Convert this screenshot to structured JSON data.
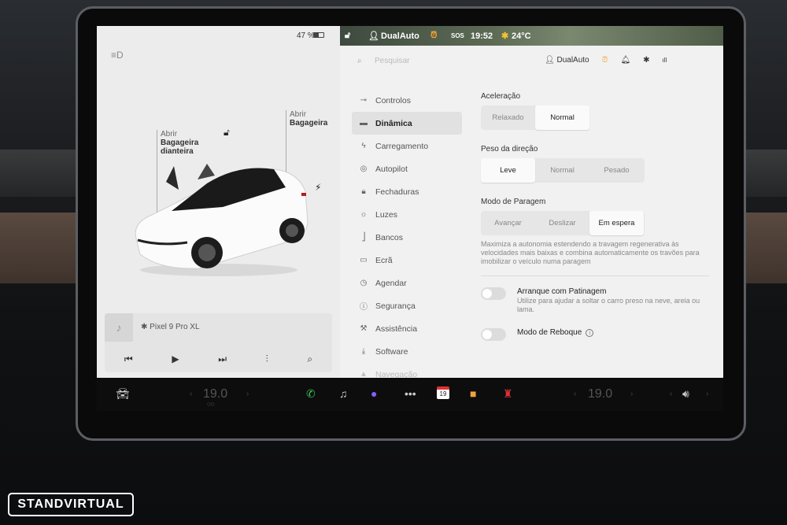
{
  "status": {
    "battery": "47 %",
    "profile": "DualAuto",
    "sos": "SOS",
    "time": "19:52",
    "temperature": "24°C"
  },
  "left_panel": {
    "trunk_front": {
      "line1": "Abrir",
      "line2": "Bagageira",
      "line3": "dianteira"
    },
    "trunk_rear": {
      "line1": "Abrir",
      "line2": "Bagageira"
    },
    "media": {
      "source": "Pixel 9 Pro XL"
    }
  },
  "search": {
    "placeholder": "Pesquisar"
  },
  "profile_name": "DualAuto",
  "menu": [
    {
      "label": "Controlos",
      "icon": "toggle-icon"
    },
    {
      "label": "Dinâmica",
      "icon": "car-icon"
    },
    {
      "label": "Carregamento",
      "icon": "bolt-icon"
    },
    {
      "label": "Autopilot",
      "icon": "steering-icon"
    },
    {
      "label": "Fechaduras",
      "icon": "lock-icon"
    },
    {
      "label": "Luzes",
      "icon": "sun-icon"
    },
    {
      "label": "Bancos",
      "icon": "seat-icon"
    },
    {
      "label": "Ecrã",
      "icon": "screen-icon"
    },
    {
      "label": "Agendar",
      "icon": "clock-icon"
    },
    {
      "label": "Segurança",
      "icon": "shield-icon"
    },
    {
      "label": "Assistência",
      "icon": "wrench-icon"
    },
    {
      "label": "Software",
      "icon": "download-icon"
    },
    {
      "label": "Navegação",
      "icon": "navigation-icon"
    }
  ],
  "dynamics": {
    "acceleration": {
      "title": "Aceleração",
      "options": [
        "Relaxado",
        "Normal"
      ],
      "selected": "Normal"
    },
    "steering": {
      "title": "Peso da direção",
      "options": [
        "Leve",
        "Normal",
        "Pesado"
      ],
      "selected": "Leve"
    },
    "stopping": {
      "title": "Modo de Paragem",
      "options": [
        "Avançar",
        "Deslizar",
        "Em espera"
      ],
      "selected": "Em espera",
      "description": "Maximiza a autonomia estendendo a travagem regenerativa às velocidades mais baixas e combina automaticamente os travões para imobilizar o veículo numa paragem"
    },
    "slip_start": {
      "label": "Arranque com Patinagem",
      "description": "Utilize para ajudar a soltar o carro preso na neve, areia ou lama.",
      "on": false
    },
    "tow_mode": {
      "label": "Modo de Reboque",
      "on": false
    }
  },
  "taskbar": {
    "temp_left": "19.0",
    "calendar_day": "19",
    "temp_right": "19.0"
  },
  "watermark": "STANDVIRTUAL"
}
